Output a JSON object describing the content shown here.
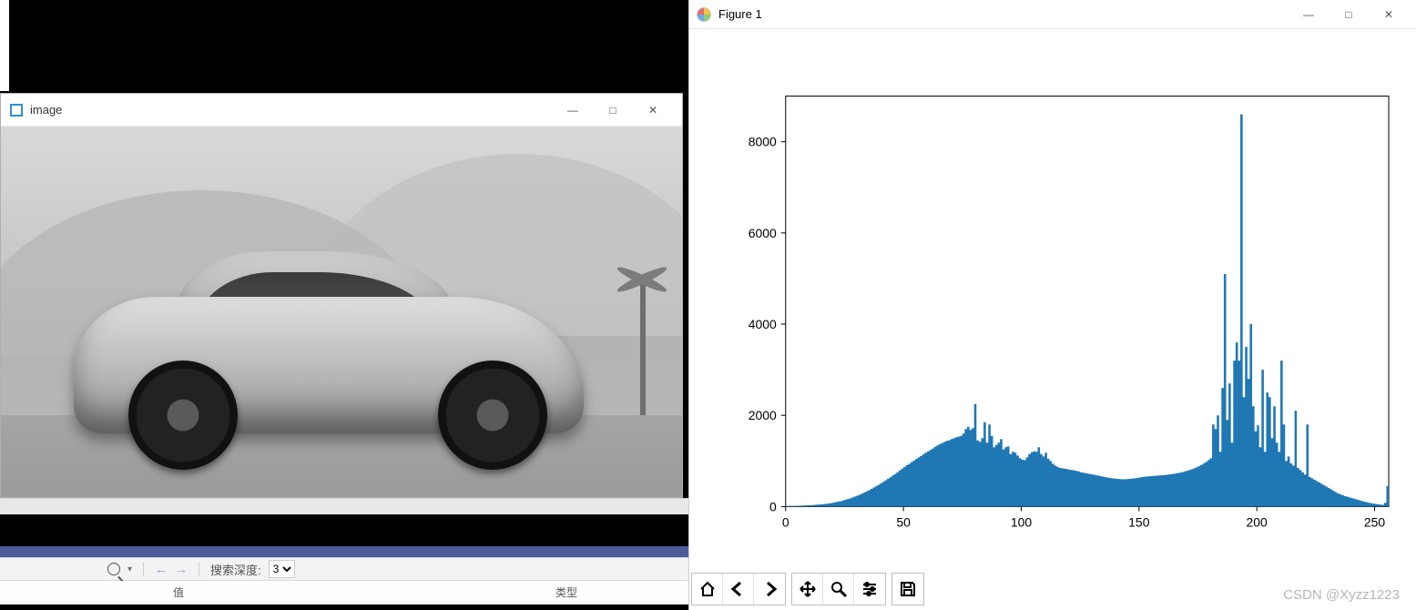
{
  "left": {
    "image_window": {
      "title": "image",
      "icon": "opencv-icon",
      "win_buttons": {
        "minimize": "—",
        "maximize": "□",
        "close": "✕"
      }
    },
    "status": {
      "search_placeholder": "",
      "depth_label": "搜索深度:",
      "depth_value": "3"
    },
    "columns": {
      "name": "",
      "value": "值",
      "type": "类型"
    }
  },
  "figure": {
    "title": "Figure 1",
    "win_buttons": {
      "minimize": "—",
      "maximize": "□",
      "close": "✕"
    },
    "toolbar": {
      "home": "home-icon",
      "back": "back-icon",
      "forward": "forward-icon",
      "pan": "pan-icon",
      "zoom": "zoom-icon",
      "config": "config-icon",
      "save": "save-icon"
    }
  },
  "watermark": "CSDN @Xyzz1223",
  "chart_data": {
    "type": "bar",
    "title": "",
    "xlabel": "",
    "ylabel": "",
    "xlim": [
      0,
      256
    ],
    "ylim": [
      0,
      9000
    ],
    "xticks": [
      0,
      50,
      100,
      150,
      200,
      250
    ],
    "yticks": [
      0,
      2000,
      4000,
      6000,
      8000
    ],
    "categories_note": "x = 0..255 (grayscale pixel intensity histogram)",
    "values": [
      10,
      12,
      14,
      15,
      16,
      18,
      20,
      22,
      25,
      27,
      30,
      34,
      38,
      42,
      46,
      50,
      56,
      62,
      70,
      78,
      88,
      100,
      110,
      120,
      135,
      150,
      165,
      180,
      200,
      220,
      240,
      260,
      285,
      310,
      335,
      360,
      390,
      420,
      450,
      480,
      510,
      540,
      575,
      610,
      645,
      680,
      715,
      750,
      790,
      830,
      870,
      905,
      940,
      975,
      1010,
      1045,
      1080,
      1110,
      1145,
      1180,
      1210,
      1240,
      1275,
      1310,
      1340,
      1370,
      1395,
      1420,
      1440,
      1455,
      1480,
      1500,
      1520,
      1535,
      1550,
      1600,
      1700,
      1750,
      1680,
      1720,
      2250,
      1450,
      1420,
      1500,
      1850,
      1400,
      1800,
      1550,
      1300,
      1350,
      1400,
      1480,
      1250,
      1300,
      1320,
      1150,
      1200,
      1180,
      1120,
      1060,
      1030,
      1020,
      1080,
      1150,
      1190,
      1210,
      1200,
      1300,
      1150,
      1100,
      1180,
      1050,
      1000,
      940,
      900,
      870,
      850,
      840,
      830,
      820,
      810,
      800,
      790,
      780,
      770,
      750,
      740,
      730,
      720,
      710,
      700,
      690,
      680,
      670,
      660,
      650,
      640,
      630,
      620,
      615,
      610,
      605,
      600,
      600,
      600,
      605,
      610,
      615,
      620,
      630,
      640,
      650,
      655,
      660,
      665,
      668,
      672,
      676,
      680,
      684,
      688,
      694,
      700,
      708,
      716,
      724,
      734,
      744,
      756,
      770,
      784,
      800,
      818,
      838,
      860,
      886,
      914,
      946,
      980,
      1018,
      1060,
      1800,
      1700,
      2000,
      1200,
      2600,
      5100,
      1900,
      2700,
      1400,
      3200,
      3600,
      3200,
      8600,
      2400,
      3500,
      2800,
      4000,
      2200,
      1650,
      1780,
      1300,
      3000,
      1200,
      2500,
      2400,
      1500,
      2200,
      1400,
      1200,
      3200,
      1800,
      1000,
      1100,
      950,
      900,
      2100,
      850,
      800,
      750,
      700,
      1800,
      650,
      620,
      590,
      560,
      530,
      500,
      470,
      440,
      410,
      380,
      350,
      320,
      290,
      270,
      250,
      230,
      215,
      200,
      185,
      170,
      155,
      140,
      125,
      110,
      98,
      86,
      76,
      66,
      58,
      50,
      44,
      38,
      80,
      450
    ]
  }
}
